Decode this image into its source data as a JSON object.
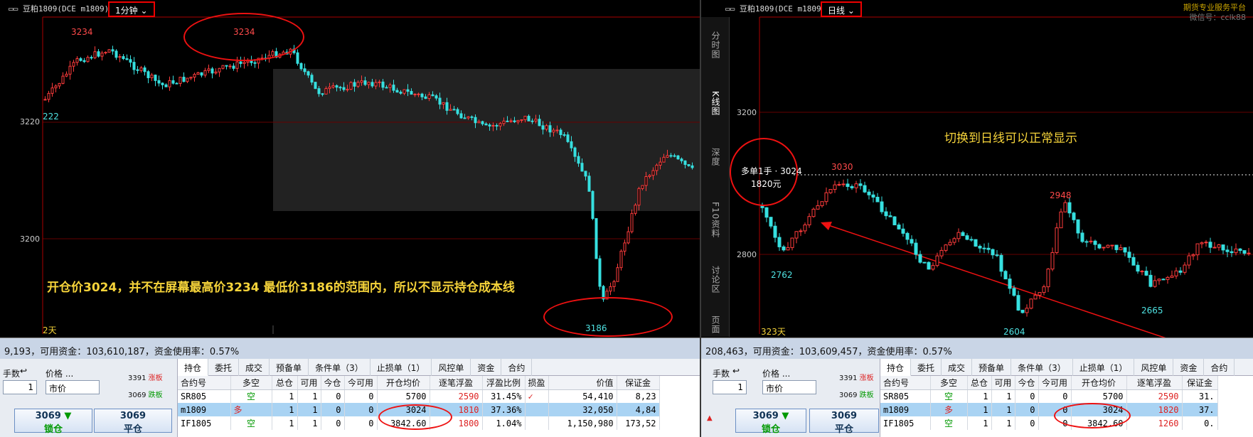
{
  "left": {
    "title": "▭▭ 豆粕1809(DCE m1809)",
    "period": "1分钟",
    "y_ticks": [
      "3220",
      "3200"
    ],
    "high_label_1": "3234",
    "high_label_2": "3234",
    "low_label": "3186",
    "left_edge_label": "222",
    "days": "2天",
    "annotation": "开仓价3024，并不在屏幕最高价3234 最低价3186的范围内，所以不显示持仓成本线",
    "status": "9,193，可用资金：103,610,187，资金使用率：0.57%",
    "order": {
      "qty_label": "手数",
      "qty_value": "1",
      "price_label": "价格 ...",
      "price_value": "市价",
      "limit_up": "3391",
      "limit_up_tag": "涨板",
      "limit_down": "3069",
      "limit_down_tag": "跌板",
      "btn1_price": "3069",
      "btn1_label": "锁仓",
      "btn2_price": "3069",
      "btn2_label": "平仓"
    },
    "tabs": [
      "持仓",
      "委托",
      "成交",
      "预备单",
      "条件单（3）",
      "止损单（1）",
      "风控单",
      "资金",
      "合约"
    ],
    "headers": [
      "合约号",
      "多空",
      "总仓",
      "可用",
      "今仓",
      "今可用",
      "开仓均价",
      "逐笔浮盈",
      "浮盈比例",
      "损盈",
      "价值",
      "保证金"
    ],
    "rows": [
      [
        "SR805",
        "空",
        "1",
        "1",
        "0",
        "0",
        "5700",
        "2590",
        "31.45%",
        "✓",
        "54,410",
        "8,23"
      ],
      [
        "m1809",
        "多",
        "1",
        "1",
        "0",
        "0",
        "3024",
        "1810",
        "37.36%",
        "",
        "32,050",
        "4,84"
      ],
      [
        "IF1805",
        "空",
        "1",
        "1",
        "0",
        "0",
        "3842.60",
        "1800",
        "1.04%",
        "",
        "1,150,980",
        "173,52"
      ]
    ]
  },
  "right": {
    "title": "▭▭ 豆粕1809(DCE m1809)",
    "period": "日线",
    "watermark_1": "期货专业服务平台",
    "watermark_2": "微信号：cclk88",
    "side_tabs": [
      "分时图",
      "K线图",
      "深度",
      "F10资料",
      "讨论区",
      "页面"
    ],
    "y_ticks": [
      "3200",
      "2800"
    ],
    "annotation": "切换到日线可以正常显示",
    "position_tag_1": "多单1手",
    "position_tag_2": "1820元",
    "cost_price": "3024",
    "high_label": "3030",
    "peak_label": "2948",
    "low_labels": [
      "2762",
      "2604",
      "2665"
    ],
    "days": "323天",
    "status": "208,463，可用资金：103,609,457，资金使用率：0.57%",
    "order": {
      "qty_label": "手数",
      "qty_value": "1",
      "price_label": "价格 ...",
      "price_value": "市价",
      "limit_up": "3391",
      "limit_up_tag": "涨板",
      "limit_down": "3069",
      "limit_down_tag": "跌板",
      "btn1_price": "3069",
      "btn1_label": "锁仓",
      "btn2_price": "3069",
      "btn2_label": "平仓"
    },
    "tabs": [
      "持仓",
      "委托",
      "成交",
      "预备单",
      "条件单（3）",
      "止损单（1）",
      "风控单",
      "资金",
      "合约"
    ],
    "headers": [
      "合约号",
      "多空",
      "总仓",
      "可用",
      "今仓",
      "今可用",
      "开仓均价",
      "逐笔浮盈",
      "保证金"
    ],
    "rows": [
      [
        "SR805",
        "空",
        "1",
        "1",
        "0",
        "0",
        "5700",
        "2590",
        "31."
      ],
      [
        "m1809",
        "多",
        "1",
        "1",
        "0",
        "0",
        "3024",
        "1820",
        "37."
      ],
      [
        "IF1805",
        "空",
        "1",
        "1",
        "0",
        "0",
        "3842.60",
        "1260",
        "0."
      ]
    ]
  },
  "colors": {
    "up": "#ff3b3b",
    "down": "#36e0e0",
    "accent_red": "#e11111",
    "annotation": "#f5d33a"
  }
}
